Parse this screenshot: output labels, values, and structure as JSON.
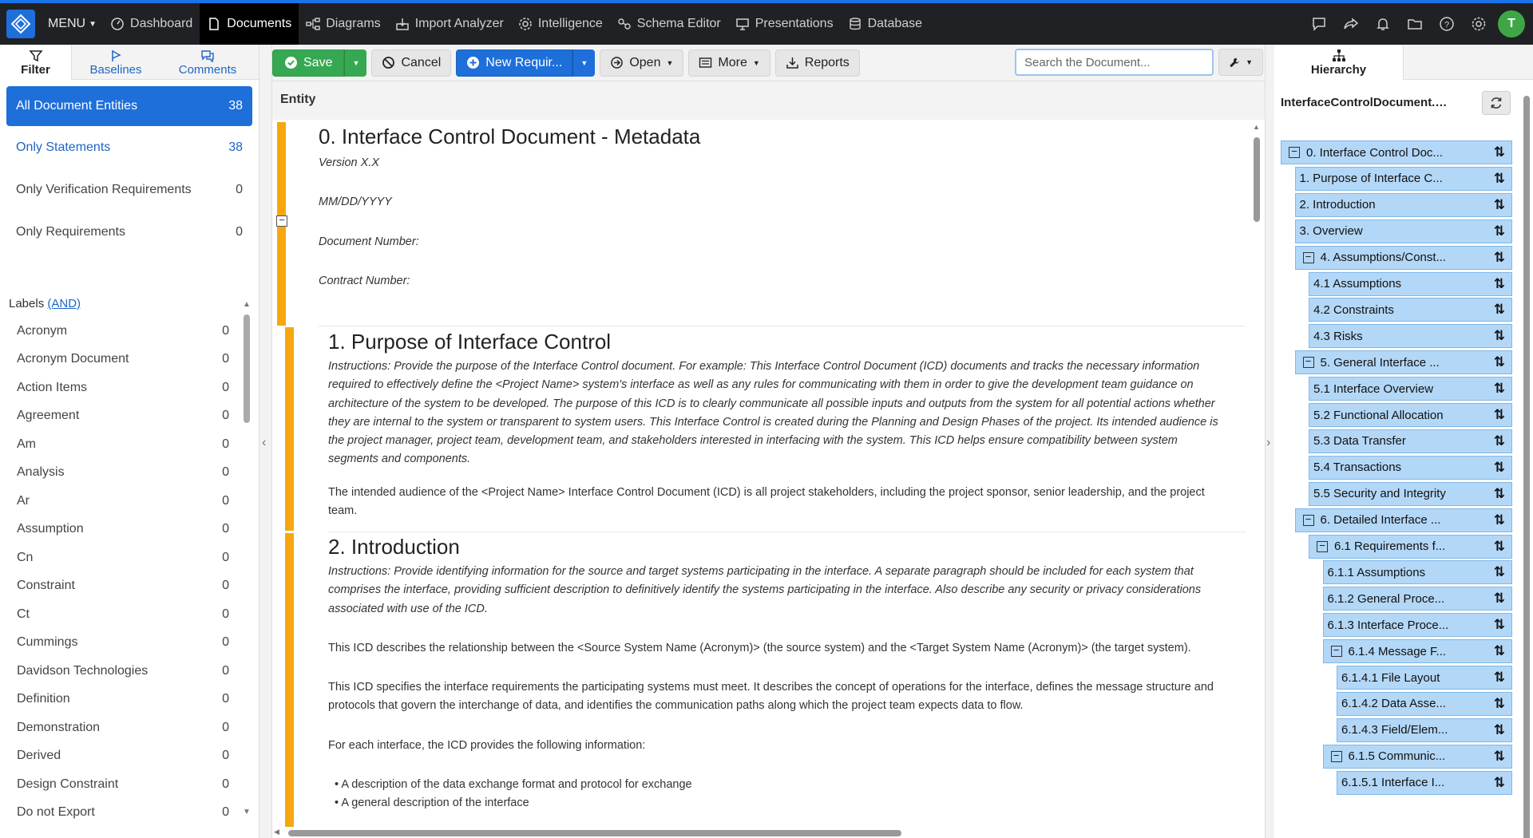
{
  "colors": {
    "accent": "#1e6fd9",
    "save": "#36a852",
    "section_bar": "#f6a70f",
    "tree_node": "#b3d7f7",
    "avatar": "#3ea646"
  },
  "topnav": {
    "menu_label": "MENU",
    "items": [
      {
        "label": "Dashboard",
        "icon": "dashboard-icon"
      },
      {
        "label": "Documents",
        "icon": "document-icon",
        "active": true
      },
      {
        "label": "Diagrams",
        "icon": "diagram-icon"
      },
      {
        "label": "Import Analyzer",
        "icon": "import-icon"
      },
      {
        "label": "Intelligence",
        "icon": "gear-brain-icon"
      },
      {
        "label": "Schema Editor",
        "icon": "schema-icon"
      },
      {
        "label": "Presentations",
        "icon": "presentation-icon"
      },
      {
        "label": "Database",
        "icon": "database-icon"
      }
    ],
    "avatar_initial": "T"
  },
  "left": {
    "tabs": [
      {
        "label": "Filter",
        "icon": "filter-icon"
      },
      {
        "label": "Baselines",
        "icon": "flag-icon"
      },
      {
        "label": "Comments",
        "icon": "comments-icon"
      }
    ],
    "filters": [
      {
        "label": "All Document Entities",
        "count": "38"
      },
      {
        "label": "Only Statements",
        "count": "38"
      },
      {
        "label": "Only Verification Requirements",
        "count": "0"
      },
      {
        "label": "Only Requirements",
        "count": "0"
      }
    ],
    "labels_title": "Labels",
    "labels_mode": "(AND)",
    "labels": [
      {
        "label": "Acronym",
        "count": "0"
      },
      {
        "label": "Acronym Document",
        "count": "0"
      },
      {
        "label": "Action Items",
        "count": "0"
      },
      {
        "label": "Agreement",
        "count": "0"
      },
      {
        "label": "Am",
        "count": "0"
      },
      {
        "label": "Analysis",
        "count": "0"
      },
      {
        "label": "Ar",
        "count": "0"
      },
      {
        "label": "Assumption",
        "count": "0"
      },
      {
        "label": "Cn",
        "count": "0"
      },
      {
        "label": "Constraint",
        "count": "0"
      },
      {
        "label": "Ct",
        "count": "0"
      },
      {
        "label": "Cummings",
        "count": "0"
      },
      {
        "label": "Davidson Technologies",
        "count": "0"
      },
      {
        "label": "Definition",
        "count": "0"
      },
      {
        "label": "Demonstration",
        "count": "0"
      },
      {
        "label": "Derived",
        "count": "0"
      },
      {
        "label": "Design Constraint",
        "count": "0"
      },
      {
        "label": "Do not Export",
        "count": "0"
      }
    ]
  },
  "toolbar": {
    "save": "Save",
    "cancel": "Cancel",
    "new_req": "New Requir...",
    "open": "Open",
    "more": "More",
    "reports": "Reports",
    "search_placeholder": "Search the Document..."
  },
  "doc": {
    "entity_header": "Entity",
    "s0": {
      "title": "0. Interface Control Document - Metadata",
      "version": "Version X.X",
      "date": "MM/DD/YYYY",
      "docnum": "Document Number:",
      "contract": "Contract Number:"
    },
    "s1": {
      "title": "1. Purpose of Interface Control",
      "instructions": "Instructions: Provide the purpose of the Interface Control document. For example: This Interface Control Document (ICD) documents and tracks the necessary information required to effectively define the <Project Name> system's interface as well as any rules for communicating with them in order to give the development team guidance on architecture of the system to be developed. The purpose of this ICD is to clearly communicate all possible inputs and outputs from the system for all potential actions whether they are internal to the system or transparent to system users. This Interface Control is created during the Planning and Design Phases of the project. Its intended audience is the project manager, project team, development team, and stakeholders interested in interfacing with the system. This ICD helps ensure compatibility between system segments and components.",
      "audience": "The intended audience of the <Project Name> Interface Control Document (ICD) is all project stakeholders, including the project sponsor, senior leadership, and the project team."
    },
    "s2": {
      "title": "2. Introduction",
      "instructions": "Instructions: Provide identifying information for the source and target systems participating in the interface. A separate paragraph should be included for each system that comprises the interface, providing sufficient description to definitively identify the systems participating in the interface. Also describe any security or privacy considerations associated with use of the ICD.",
      "p1": "This ICD describes the relationship between the <Source System Name (Acronym)> (the source system) and the <Target System Name (Acronym)> (the target system).",
      "p2": "This ICD specifies the interface requirements the participating systems must meet. It describes the concept of operations for the interface, defines the message structure and protocols that govern the interchange of data, and identifies the communication paths along which the project team expects data to flow.",
      "p3": "For each interface, the ICD provides the following information:",
      "bullets": [
        "A description of the data exchange format and protocol for exchange",
        "A general description of the interface"
      ]
    }
  },
  "right": {
    "tab": "Hierarchy",
    "file": "InterfaceControlDocument.docx",
    "tree": [
      {
        "label": "0. Interface Control Doc...",
        "level": 0,
        "toggle": true
      },
      {
        "label": "1. Purpose of Interface C...",
        "level": 1,
        "toggle": false
      },
      {
        "label": "2. Introduction",
        "level": 1,
        "toggle": false
      },
      {
        "label": "3. Overview",
        "level": 1,
        "toggle": false
      },
      {
        "label": "4. Assumptions/Const...",
        "level": 1,
        "toggle": true
      },
      {
        "label": "4.1 Assumptions",
        "level": 2,
        "toggle": false
      },
      {
        "label": "4.2 Constraints",
        "level": 2,
        "toggle": false
      },
      {
        "label": "4.3 Risks",
        "level": 2,
        "toggle": false
      },
      {
        "label": "5. General Interface ...",
        "level": 1,
        "toggle": true
      },
      {
        "label": "5.1 Interface Overview",
        "level": 2,
        "toggle": false
      },
      {
        "label": "5.2 Functional Allocation",
        "level": 2,
        "toggle": false
      },
      {
        "label": "5.3 Data Transfer",
        "level": 2,
        "toggle": false
      },
      {
        "label": "5.4 Transactions",
        "level": 2,
        "toggle": false
      },
      {
        "label": "5.5 Security and Integrity",
        "level": 2,
        "toggle": false
      },
      {
        "label": "6. Detailed Interface ...",
        "level": 1,
        "toggle": true
      },
      {
        "label": "6.1 Requirements f...",
        "level": 2,
        "toggle": true
      },
      {
        "label": "6.1.1 Assumptions",
        "level": 3,
        "toggle": false
      },
      {
        "label": "6.1.2 General Proce...",
        "level": 3,
        "toggle": false
      },
      {
        "label": "6.1.3 Interface Proce...",
        "level": 3,
        "toggle": false
      },
      {
        "label": "6.1.4 Message F...",
        "level": 3,
        "toggle": true
      },
      {
        "label": "6.1.4.1 File Layout",
        "level": 4,
        "toggle": false
      },
      {
        "label": "6.1.4.2 Data Asse...",
        "level": 4,
        "toggle": false
      },
      {
        "label": "6.1.4.3 Field/Elem...",
        "level": 4,
        "toggle": false
      },
      {
        "label": "6.1.5 Communic...",
        "level": 3,
        "toggle": true
      },
      {
        "label": "6.1.5.1 Interface I...",
        "level": 4,
        "toggle": false
      }
    ]
  }
}
